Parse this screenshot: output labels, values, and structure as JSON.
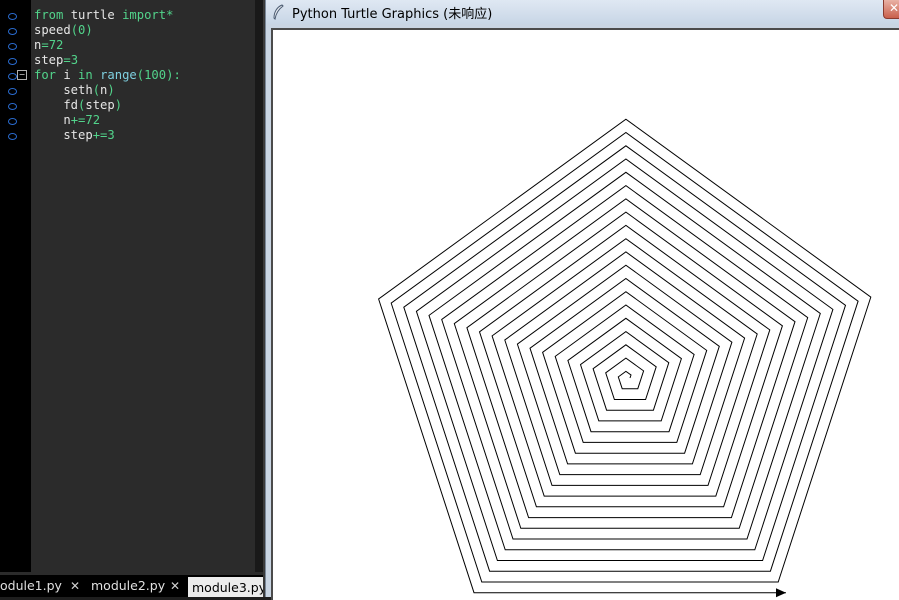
{
  "editor": {
    "lines": [
      {
        "segments": [
          {
            "t": "from",
            "c": "kw"
          },
          {
            "t": " turtle ",
            "c": ""
          },
          {
            "t": "import",
            "c": "kw"
          },
          {
            "t": "*",
            "c": "op"
          }
        ]
      },
      {
        "segments": [
          {
            "t": "speed",
            "c": ""
          },
          {
            "t": "(",
            "c": "op"
          },
          {
            "t": "0",
            "c": "num"
          },
          {
            "t": ")",
            "c": "op"
          }
        ]
      },
      {
        "segments": [
          {
            "t": "n",
            "c": ""
          },
          {
            "t": "=",
            "c": "op"
          },
          {
            "t": "72",
            "c": "num"
          }
        ]
      },
      {
        "segments": [
          {
            "t": "step",
            "c": ""
          },
          {
            "t": "=",
            "c": "op"
          },
          {
            "t": "3",
            "c": "num"
          }
        ]
      },
      {
        "segments": [
          {
            "t": "for",
            "c": "kw"
          },
          {
            "t": " i ",
            "c": ""
          },
          {
            "t": "in",
            "c": "kw"
          },
          {
            "t": " ",
            "c": ""
          },
          {
            "t": "range",
            "c": "bi"
          },
          {
            "t": "(",
            "c": "op"
          },
          {
            "t": "100",
            "c": "num"
          },
          {
            "t": "):",
            "c": "op"
          }
        ]
      },
      {
        "segments": [
          {
            "t": "    seth",
            "c": ""
          },
          {
            "t": "(",
            "c": "op"
          },
          {
            "t": "n",
            "c": ""
          },
          {
            "t": ")",
            "c": "op"
          }
        ]
      },
      {
        "segments": [
          {
            "t": "    fd",
            "c": ""
          },
          {
            "t": "(",
            "c": "op"
          },
          {
            "t": "step",
            "c": ""
          },
          {
            "t": ")",
            "c": "op"
          }
        ]
      },
      {
        "segments": [
          {
            "t": "    n",
            "c": ""
          },
          {
            "t": "+=",
            "c": "op"
          },
          {
            "t": "72",
            "c": "num"
          }
        ]
      },
      {
        "segments": [
          {
            "t": "    step",
            "c": ""
          },
          {
            "t": "+=",
            "c": "op"
          },
          {
            "t": "3",
            "c": "num"
          }
        ]
      }
    ],
    "fold_symbol": "−"
  },
  "tabs": [
    {
      "label": "odule1.py",
      "close": "✕",
      "active": false
    },
    {
      "label": "module2.py",
      "close": "✕",
      "active": false
    },
    {
      "label": "module3.py",
      "active": true
    }
  ],
  "turtle_window": {
    "title": "Python Turtle Graphics (未响应)",
    "close_symbol": "✕",
    "drawing": {
      "iterations": 100,
      "heading_start": 72,
      "heading_increment": 72,
      "step_start": 3,
      "step_increment": 3,
      "line_color": "#000000"
    }
  },
  "colors": {
    "keyword": "#52d48b",
    "builtin": "#7fd0e0",
    "editor_bg": "#2b2b2b",
    "marker": "#2a6cd0"
  }
}
